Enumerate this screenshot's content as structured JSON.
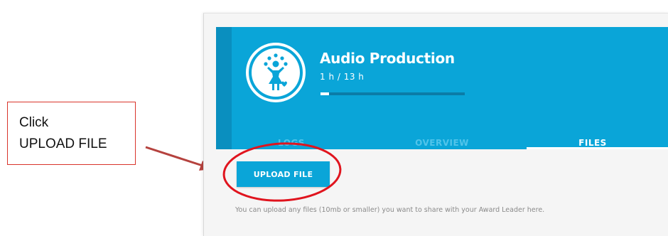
{
  "callout": {
    "line1": "Click",
    "line2": "UPLOAD FILE"
  },
  "award": {
    "title": "Audio Production",
    "hours": "1 h / 13 h",
    "progress": 0.06,
    "icon": "juggler-figure-icon"
  },
  "tabs": [
    {
      "label": "LOGS",
      "active": false
    },
    {
      "label": "OVERVIEW",
      "active": false
    },
    {
      "label": "FILES",
      "active": true
    }
  ],
  "upload_button": "UPLOAD FILE",
  "help_text": "You can upload any files (10mb or smaller) you want to share with your Award Leader here.",
  "colors": {
    "accent": "#0aa5d8",
    "callout_border": "#d9342b",
    "annotation": "#e0141e",
    "arrow": "#b5423e"
  }
}
